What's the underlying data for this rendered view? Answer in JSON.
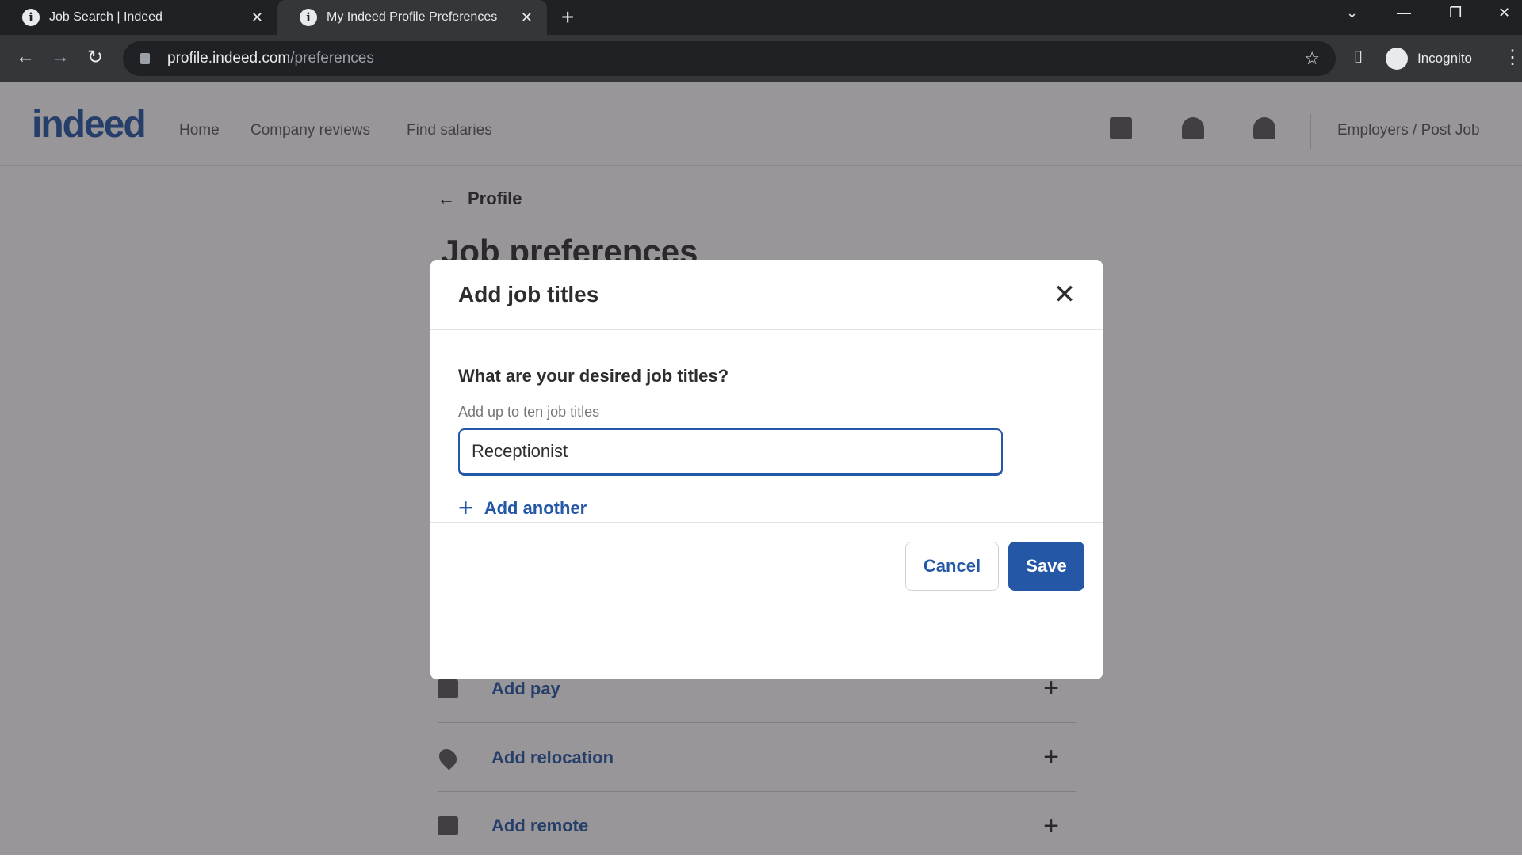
{
  "browser": {
    "tabs": [
      {
        "title": "Job Search | Indeed",
        "active": false
      },
      {
        "title": "My Indeed Profile Preferences",
        "active": true
      }
    ],
    "url_host": "profile.indeed.com",
    "url_path": "/preferences",
    "profile_label": "Incognito"
  },
  "header": {
    "logo": "indeed",
    "nav": [
      "Home",
      "Company reviews",
      "Find salaries"
    ],
    "employers": "Employers / Post Job"
  },
  "page": {
    "back_label": "Profile",
    "title": "Job preferences",
    "rows": [
      {
        "label": "Add pay",
        "icon": "money-icon"
      },
      {
        "label": "Add relocation",
        "icon": "location-pin-icon"
      },
      {
        "label": "Add remote",
        "icon": "home-icon"
      }
    ]
  },
  "modal": {
    "title": "Add job titles",
    "question": "What are your desired job titles?",
    "hint": "Add up to ten job titles",
    "input_value": "Receptionist",
    "add_another": "Add another",
    "cancel": "Cancel",
    "save": "Save"
  },
  "colors": {
    "brand": "#2557a7"
  }
}
